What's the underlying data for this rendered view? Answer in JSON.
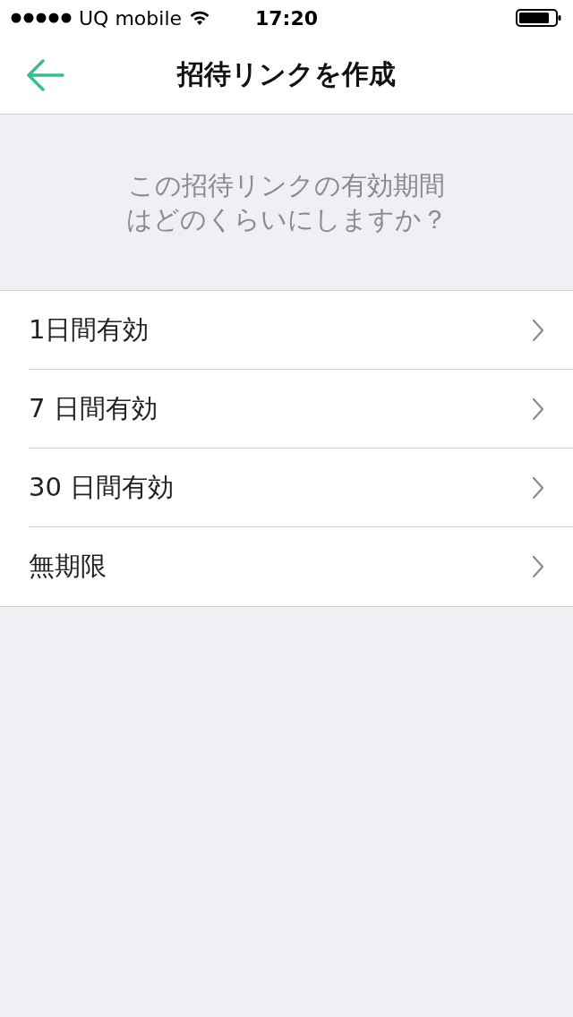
{
  "status_bar": {
    "carrier": "UQ mobile",
    "time": "17:20"
  },
  "nav_bar": {
    "title": "招待リンクを作成"
  },
  "prompt": "この招待リンクの有効期間はどのくらいにしますか？",
  "options": [
    {
      "label": "1日間有効"
    },
    {
      "label": "7 日間有効"
    },
    {
      "label": "30 日間有効"
    },
    {
      "label": "無期限"
    }
  ]
}
